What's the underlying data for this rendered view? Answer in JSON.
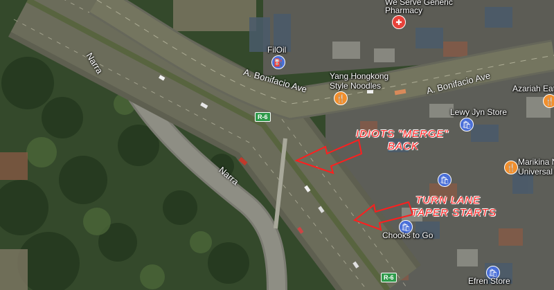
{
  "roads": {
    "bonifacio_upper": "A. Bonifacio Ave",
    "bonifacio_lower": "A. Bonifacio Ave",
    "narra_upper": "Narra",
    "narra_lower": "Narra"
  },
  "shields": {
    "r6_upper": "R-6",
    "r6_lower": "R-6"
  },
  "places": {
    "pharmacy": "We Serve Generic Pharmacy",
    "pharmacy_line1": "We Serve Generic",
    "pharmacy_line2": "Pharmacy",
    "filoil": "FilOil",
    "yang_line1": "Yang Hongkong",
    "yang_line2": "Style Noodles",
    "azariah": "Azariah Eate",
    "lewy": "Lewy Jyn Store",
    "marikina_line1": "Marikina N",
    "marikina_line2": "Universal C",
    "chooks": "Chooks to Go",
    "efren": "Efren Store"
  },
  "icons": {
    "pharmacy": "pharmacy-icon",
    "fuel": "fuel-icon",
    "restaurant": "restaurant-icon",
    "shopping": "shopping-icon"
  },
  "annotations": {
    "merge_line1": "IDIOTS \"MERGE\"",
    "merge_line2": "BACK",
    "taper_line1": "TURN LANE",
    "taper_line2": "TAPER STARTS"
  },
  "colors": {
    "annotation": "#ff1e1e",
    "vegetation": "#2f4a26",
    "road": "#6f6f62",
    "pin_shop": "#4a6fd8",
    "pin_food": "#f18f2d",
    "pin_pharmacy": "#e8423a"
  }
}
